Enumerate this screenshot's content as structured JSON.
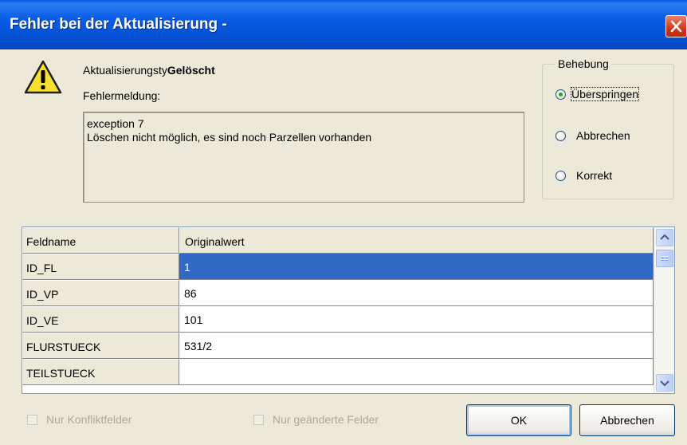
{
  "window": {
    "title": "Fehler bei der Aktualisierung -"
  },
  "info": {
    "type_label": "Aktualisierungsty",
    "type_value": "Gelöscht",
    "message_label": "Fehlermeldung:",
    "message_lines": [
      "exception 7",
      "Löschen nicht möglich, es sind noch Parzellen vorhanden"
    ]
  },
  "resolution": {
    "legend": "Behebung",
    "options": [
      {
        "label": "Überspringen",
        "checked": true
      },
      {
        "label": "Abbrechen",
        "checked": false
      },
      {
        "label": "Korrekt",
        "checked": false
      }
    ]
  },
  "table": {
    "columns": [
      "Feldname",
      "Originalwert"
    ],
    "rows": [
      [
        "ID_FL",
        "1"
      ],
      [
        "ID_VP",
        "86"
      ],
      [
        "ID_VE",
        "101"
      ],
      [
        "FLURSTUECK",
        "531/2"
      ],
      [
        "TEILSTUECK",
        ""
      ]
    ],
    "selected_row": 0
  },
  "filters": {
    "only_conflicts": "Nur Konfliktfelder",
    "only_changed": "Nur geänderte Felder"
  },
  "buttons": {
    "ok": "OK",
    "cancel": "Abbrechen"
  },
  "colors": {
    "title_bar": "#0553d6",
    "selection": "#316ac5",
    "close_button": "#d0391a"
  },
  "icons": {
    "warning": "warning-icon",
    "close": "close-icon",
    "scroll_up": "chevron-up-icon",
    "scroll_down": "chevron-down-icon"
  }
}
